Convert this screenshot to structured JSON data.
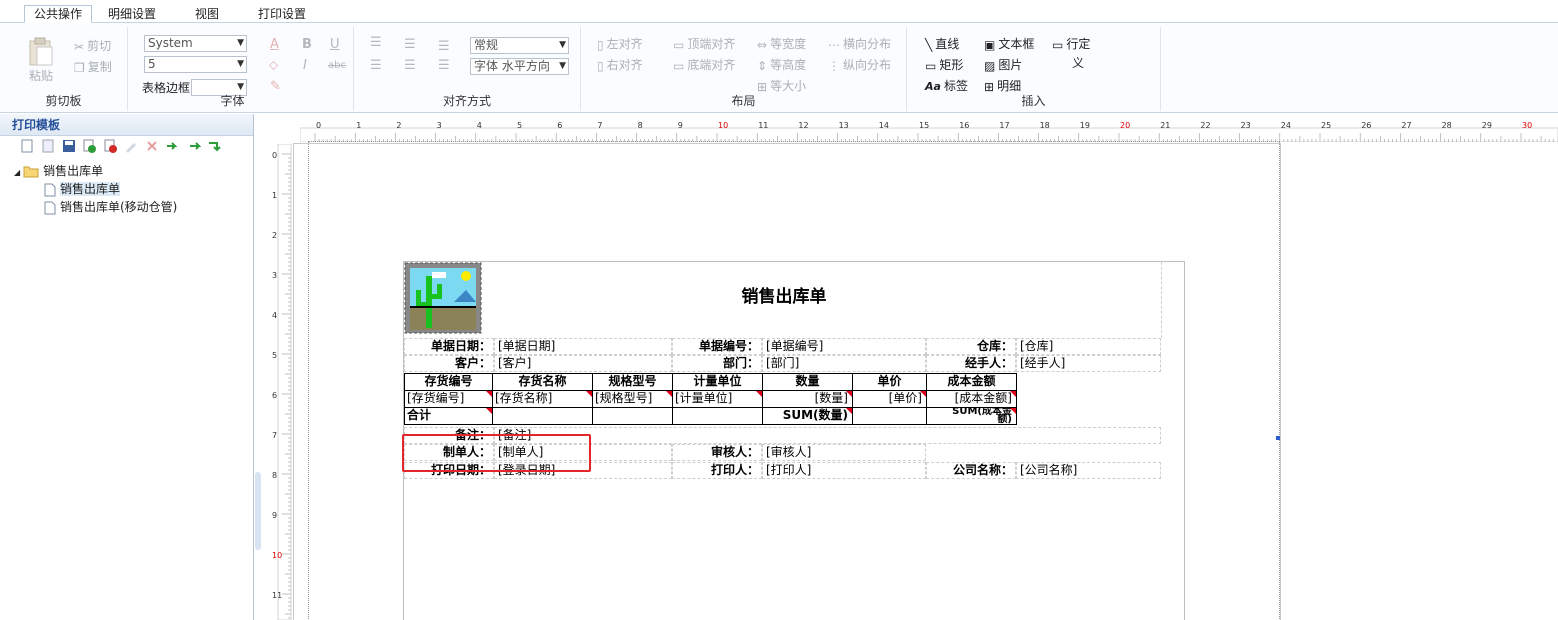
{
  "tabs": [
    "公共操作",
    "明细设置",
    "视图",
    "打印设置"
  ],
  "ribbon": {
    "clipboard": {
      "label": "剪切板",
      "paste": "粘贴",
      "cut": "剪切",
      "copy": "复制"
    },
    "font": {
      "label": "字体",
      "font_name": "System",
      "font_size": "5",
      "border_label": "表格边框",
      "bold": "B",
      "italic": "I",
      "underline": "U",
      "strike": "abc"
    },
    "align": {
      "label": "对齐方式",
      "style": "常规",
      "direction": "字体 水平方向"
    },
    "layout": {
      "label": "布局",
      "left_align": "左对齐",
      "right_align": "右对齐",
      "top_align": "顶端对齐",
      "bottom_align": "底端对齐",
      "same_width": "等宽度",
      "same_height": "等高度",
      "same_size": "等大小",
      "h_distribute": "横向分布",
      "v_distribute": "纵向分布"
    },
    "insert": {
      "label": "插入",
      "line": "直线",
      "rect": "矩形",
      "tag": "标签",
      "textbox": "文本框",
      "image": "图片",
      "detail": "明细",
      "row_def_1": "行定",
      "row_def_2": "义"
    }
  },
  "panel": {
    "title": "打印模板",
    "tree_root": "销售出库单",
    "tree_items": [
      "销售出库单",
      "销售出库单(移动仓管)"
    ]
  },
  "ruler": {
    "h_labels": [
      "0",
      "1",
      "2",
      "3",
      "4",
      "5",
      "6",
      "7",
      "8",
      "9",
      "10",
      "11",
      "12",
      "13",
      "14",
      "15",
      "16",
      "17",
      "18",
      "19",
      "20",
      "21",
      "22",
      "23",
      "24",
      "25",
      "26",
      "27",
      "28",
      "29",
      "30"
    ],
    "v_labels": [
      "0",
      "1",
      "2",
      "3",
      "4",
      "5",
      "6",
      "7",
      "8",
      "9",
      "10",
      "11"
    ]
  },
  "report": {
    "title": "销售出库单",
    "row1": {
      "date_label": "单据日期：",
      "date_val": "[单据日期]",
      "no_label": "单据编号：",
      "no_val": "[单据编号]",
      "wh_label": "仓库：",
      "wh_val": "[仓库]"
    },
    "row2": {
      "cust_label": "客户：",
      "cust_val": "[客户]",
      "dept_label": "部门：",
      "dept_val": "[部门]",
      "handler_label": "经手人：",
      "handler_val": "[经手人]"
    },
    "table": {
      "headers": [
        "存货编号",
        "存货名称",
        "规格型号",
        "计量单位",
        "数量",
        "单价",
        "成本金额"
      ],
      "cells": [
        "[存货编号]",
        "[存货名称]",
        "[规格型号]",
        "[计量单位]",
        "[数量]",
        "[单价]",
        "[成本金额]"
      ],
      "total_label": "合计",
      "sum_qty": "SUM(数量)",
      "sum_cost_1": "SUM(成本金",
      "sum_cost_2": "额)"
    },
    "remark": {
      "label": "备注：",
      "val": "[备注]"
    },
    "row_maker": {
      "maker_label": "制单人：",
      "maker_val": "[制单人]",
      "audit_label": "审核人：",
      "audit_val": "[审核人]"
    },
    "row_print": {
      "pdate_label": "打印日期：",
      "pdate_val": "[登录日期]",
      "printer_label": "打印人：",
      "printer_val": "[打印人]",
      "company_label": "公司名称：",
      "company_val": "[公司名称]"
    }
  }
}
